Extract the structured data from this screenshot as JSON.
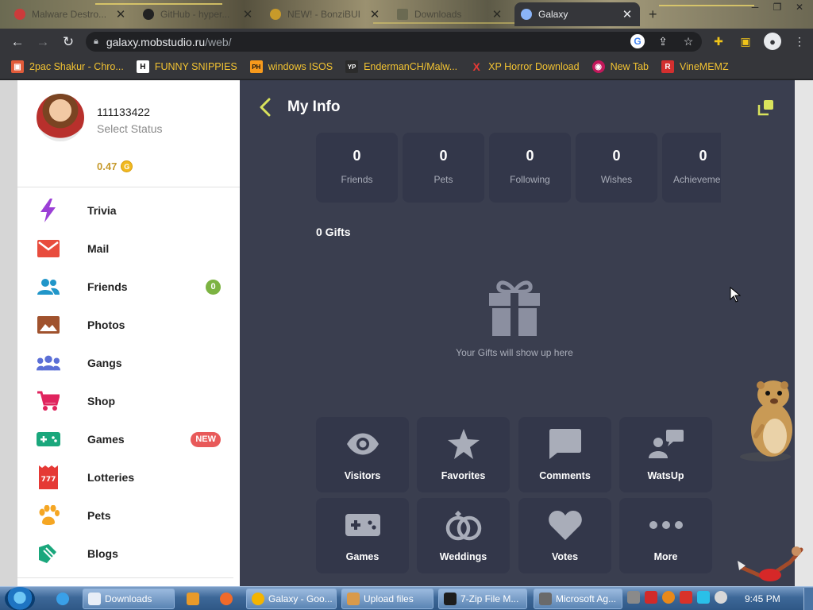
{
  "browser": {
    "tabs": [
      {
        "title": "Malware Destro...",
        "active": false,
        "favicon_color": "#cc3b3b"
      },
      {
        "title": "GitHub - hyper...",
        "active": false,
        "favicon_color": "#222222"
      },
      {
        "title": "NEW! - BonziBUI",
        "active": false,
        "favicon_color": "#c89a2a"
      },
      {
        "title": "Downloads",
        "active": false,
        "favicon_color": "#6b6a52"
      },
      {
        "title": "Galaxy",
        "active": true,
        "favicon_color": "#8ab4f8"
      }
    ],
    "new_tab_glyph": "+",
    "url_host": "galaxy.mobstudio.ru",
    "url_path": "/web/",
    "bookmarks": [
      {
        "label": "2pac Shakur - Chro...",
        "icon": "store-icon",
        "color": "#e15b3a",
        "glyph": "▣"
      },
      {
        "label": "FUNNY SNIPPIES",
        "icon": "h-icon",
        "color": "#1a1a1a",
        "glyph": "H"
      },
      {
        "label": "windows ISOS",
        "icon": "ph-icon",
        "color": "#f79a1c",
        "glyph": "PH"
      },
      {
        "label": "EndermanCH/Malw...",
        "icon": "yp-icon",
        "color": "#2b2b2b",
        "glyph": "YP"
      },
      {
        "label": "XP Horror Download",
        "icon": "x-icon",
        "color": "#e53935",
        "glyph": "X"
      },
      {
        "label": "New Tab",
        "icon": "globe-icon",
        "color": "#c2185b",
        "glyph": "◉"
      },
      {
        "label": "VineMEMZ",
        "icon": "r-icon",
        "color": "#d32f2f",
        "glyph": "R"
      }
    ]
  },
  "profile": {
    "username": "111133422",
    "status": "Select Status",
    "balance": "0.47",
    "coin_glyph": "G"
  },
  "menu": [
    {
      "label": "Trivia",
      "icon": "lightning-icon",
      "badge": null
    },
    {
      "label": "Mail",
      "icon": "mail-icon",
      "badge": null
    },
    {
      "label": "Friends",
      "icon": "friends-icon",
      "badge": "0",
      "badge_color": "#7cb342"
    },
    {
      "label": "Photos",
      "icon": "photos-icon",
      "badge": null
    },
    {
      "label": "Gangs",
      "icon": "gangs-icon",
      "badge": null
    },
    {
      "label": "Shop",
      "icon": "cart-icon",
      "badge": null
    },
    {
      "label": "Games",
      "icon": "gamepad-icon",
      "badge": "NEW",
      "badge_color": "#e85a5a"
    },
    {
      "label": "Lotteries",
      "icon": "lottery-ticket-icon",
      "badge": null
    },
    {
      "label": "Pets",
      "icon": "paw-icon",
      "badge": null
    },
    {
      "label": "Blogs",
      "icon": "blogs-icon",
      "badge": null
    }
  ],
  "main": {
    "title": "My Info",
    "stats": [
      {
        "value": "0",
        "label": "Friends"
      },
      {
        "value": "0",
        "label": "Pets"
      },
      {
        "value": "0",
        "label": "Following"
      },
      {
        "value": "0",
        "label": "Wishes"
      },
      {
        "value": "0",
        "label": "Achieveme"
      }
    ],
    "gifts_title": "0 Gifts",
    "gifts_empty": "Your Gifts will show up here",
    "tiles": [
      {
        "label": "Visitors",
        "icon": "eye-icon"
      },
      {
        "label": "Favorites",
        "icon": "star-icon"
      },
      {
        "label": "Comments",
        "icon": "comment-icon"
      },
      {
        "label": "WatsUp",
        "icon": "watsup-icon"
      },
      {
        "label": "Games",
        "icon": "gamepad-icon"
      },
      {
        "label": "Weddings",
        "icon": "rings-icon"
      },
      {
        "label": "Votes",
        "icon": "heart-icon"
      },
      {
        "label": "More",
        "icon": "more-dots-icon"
      }
    ]
  },
  "taskbar": {
    "items": [
      {
        "label": "Downloads",
        "color": "#e8eef7"
      },
      {
        "label": "Galaxy - Goo...",
        "color": "#f4b400"
      },
      {
        "label": "Upload files",
        "color": "#d99a4b"
      },
      {
        "label": "7-Zip File M...",
        "color": "#1d1d1d"
      },
      {
        "label": "Microsoft Ag...",
        "color": "#6a6a6a"
      }
    ],
    "clock": "9:45 PM"
  },
  "colors": {
    "accent_yellow": "#d9e35c",
    "panel_bg": "#3a3e4f",
    "card_bg": "#33374a",
    "icon_gray": "#a9adb9"
  }
}
